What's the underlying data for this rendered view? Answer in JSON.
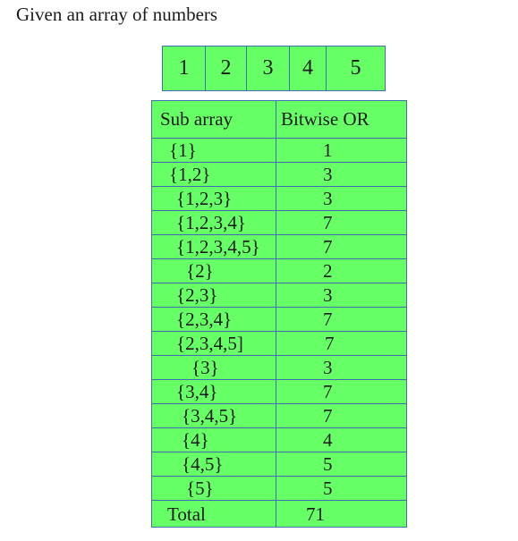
{
  "title": "Given an array of numbers",
  "array": [
    "1",
    "2",
    "3",
    "4",
    "5"
  ],
  "table": {
    "headers": {
      "subarray": "Sub array",
      "bitwise_or": "Bitwise OR"
    },
    "rows": [
      {
        "subarray": "{1}",
        "or": "1"
      },
      {
        "subarray": "{1,2}",
        "or": "3"
      },
      {
        "subarray": "{1,2,3}",
        "or": "3"
      },
      {
        "subarray": "{1,2,3,4}",
        "or": "7"
      },
      {
        "subarray": "{1,2,3,4,5}",
        "or": "7"
      },
      {
        "subarray": "{2}",
        "or": "2"
      },
      {
        "subarray": "{2,3}",
        "or": "3"
      },
      {
        "subarray": "{2,3,4}",
        "or": "7"
      },
      {
        "subarray": "{2,3,4,5]",
        "or": "7"
      },
      {
        "subarray": "{3}",
        "or": "3"
      },
      {
        "subarray": "{3,4}",
        "or": "7"
      },
      {
        "subarray": "{3,4,5}",
        "or": "7"
      },
      {
        "subarray": "{4}",
        "or": "4"
      },
      {
        "subarray": "{4,5}",
        "or": "5"
      },
      {
        "subarray": "{5}",
        "or": "5"
      }
    ],
    "total": {
      "label": "Total",
      "value": "71"
    }
  },
  "colors": {
    "cell_fill": "#66ff66",
    "cell_border": "#3f6fb0"
  }
}
